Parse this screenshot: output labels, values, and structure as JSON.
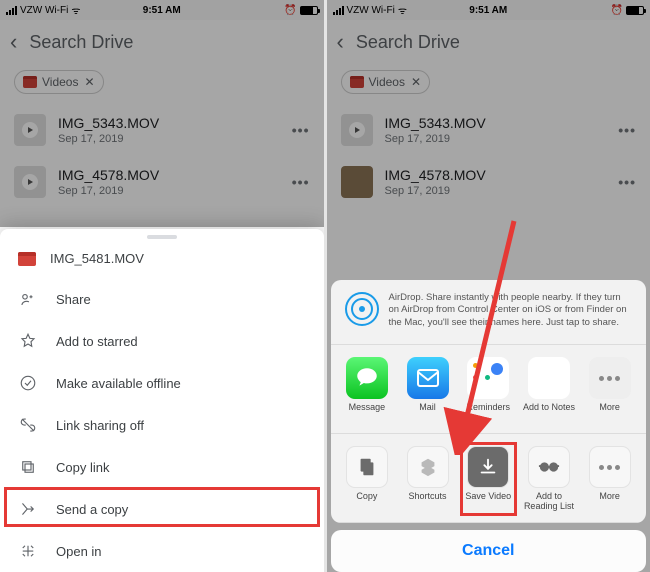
{
  "status": {
    "carrier": "VZW Wi-Fi",
    "time": "9:51 AM"
  },
  "topnav": {
    "title": "Search Drive"
  },
  "chip": {
    "label": "Videos"
  },
  "files": [
    {
      "name": "IMG_5343.MOV",
      "date": "Sep 17, 2019"
    },
    {
      "name": "IMG_4578.MOV",
      "date": "Sep 17, 2019"
    }
  ],
  "leftSheet": {
    "title": "IMG_5481.MOV",
    "options": {
      "share": "Share",
      "star": "Add to starred",
      "offline": "Make available offline",
      "linkoff": "Link sharing off",
      "copylink": "Copy link",
      "sendcopy": "Send a copy",
      "openin": "Open in"
    }
  },
  "rightSheet": {
    "airdrop": "AirDrop. Share instantly with people nearby. If they turn on AirDrop from Control Center on iOS or from Finder on the Mac, you'll see their names here. Just tap to share.",
    "apps": {
      "message": "Message",
      "mail": "Mail",
      "reminders": "Reminders",
      "notes": "Add to Notes",
      "more": "More"
    },
    "actions": {
      "copy": "Copy",
      "shortcuts": "Shortcuts",
      "savevideo": "Save Video",
      "readinglist": "Add to Reading List",
      "more": "More"
    },
    "cancel": "Cancel"
  }
}
